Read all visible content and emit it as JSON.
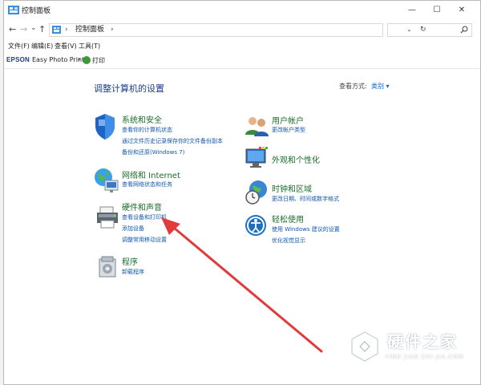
{
  "window": {
    "title": "控制面板",
    "controls": {
      "minimize": "—",
      "maximize": "☐",
      "close": "✕"
    }
  },
  "navigation": {
    "back": "←",
    "forward": "→",
    "down": "⌄",
    "up": "↑"
  },
  "address_bar": {
    "chevron": "›",
    "path": "控制面板",
    "path_chevron": "›",
    "dropdown": "⌄",
    "refresh": "↻"
  },
  "search": {
    "placeholder": ""
  },
  "menu": {
    "file": "文件(F)",
    "edit": "编辑(E)",
    "view": "查看(V)",
    "tools": "工具(T)"
  },
  "epson_bar": {
    "logo": "EPSON",
    "product": "Easy Photo Print",
    "caret": "▾",
    "print": "打印"
  },
  "main": {
    "heading": "调整计算机的设置",
    "view_by_label": "查看方式:",
    "view_by_value": "类别 ▾"
  },
  "categories": {
    "system_security": {
      "title": "系统和安全",
      "links": [
        "查看你的计算机状态",
        "通过文件历史记录保存你的文件备份副本",
        "备份和还原(Windows 7)"
      ]
    },
    "network": {
      "title": "网络和 Internet",
      "links": [
        "查看网络状态和任务"
      ]
    },
    "hardware": {
      "title": "硬件和声音",
      "links": [
        "查看设备和打印机",
        "添加设备",
        "调整常用移动设置"
      ]
    },
    "programs": {
      "title": "程序",
      "links": [
        "卸载程序"
      ]
    },
    "user_accounts": {
      "title": "用户帐户",
      "links": [
        "更改帐户类型"
      ]
    },
    "appearance": {
      "title": "外观和个性化",
      "links": []
    },
    "clock_region": {
      "title": "时钟和区域",
      "links": [
        "更改日期、时间或数字格式"
      ]
    },
    "ease_of_access": {
      "title": "轻松使用",
      "links": [
        "使用 Windows 建议的设置",
        "优化视觉显示"
      ]
    }
  },
  "watermark": {
    "title": "硬件之家",
    "subtitle": "YING JIAN ZHI JIA.COM"
  },
  "colors": {
    "link": "#1057b3",
    "category_title": "#1a6e2a",
    "heading": "#1a3e8a",
    "arrow": "#e23b3b"
  },
  "icons": [
    "control-panel-icon",
    "search-icon",
    "shield-icon",
    "globe-network-icon",
    "printer-icon",
    "programs-icon",
    "users-icon",
    "monitor-palette-icon",
    "clock-globe-icon",
    "ease-of-access-icon",
    "print-icon"
  ]
}
